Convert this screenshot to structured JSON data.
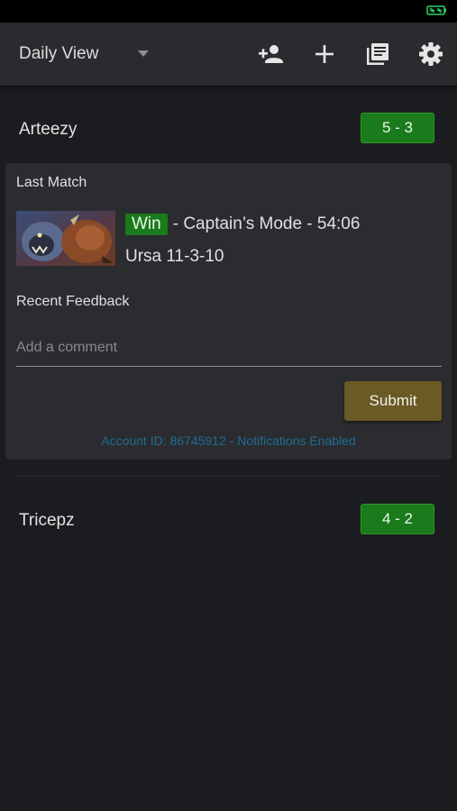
{
  "toolbar": {
    "view_label": "Daily View",
    "icons": [
      "add-person-icon",
      "plus-icon",
      "library-books-icon",
      "gear-icon"
    ]
  },
  "players": [
    {
      "name": "Arteezy",
      "record": "5 - 3"
    },
    {
      "name": "Tricepz",
      "record": "4 - 2"
    }
  ],
  "match_card": {
    "last_match_heading": "Last Match",
    "result": "Win",
    "summary": "- Captain’s Mode - 54:06",
    "hero_kda": "Ursa 11-3-10",
    "feedback_heading": "Recent Feedback",
    "comment_placeholder": "Add a comment",
    "comment_value": "",
    "submit_label": "Submit",
    "account_info": "Account ID: 86745912 - Notifications Enabled"
  },
  "colors": {
    "background": "#1b1c1f",
    "toolbar": "#2a2b2f",
    "card": "#2b2c30",
    "win_green": "#1b7a1b",
    "submit_gold": "#6a5a24",
    "link_blue": "#1f6d93",
    "battery_green": "#2ed06a"
  }
}
